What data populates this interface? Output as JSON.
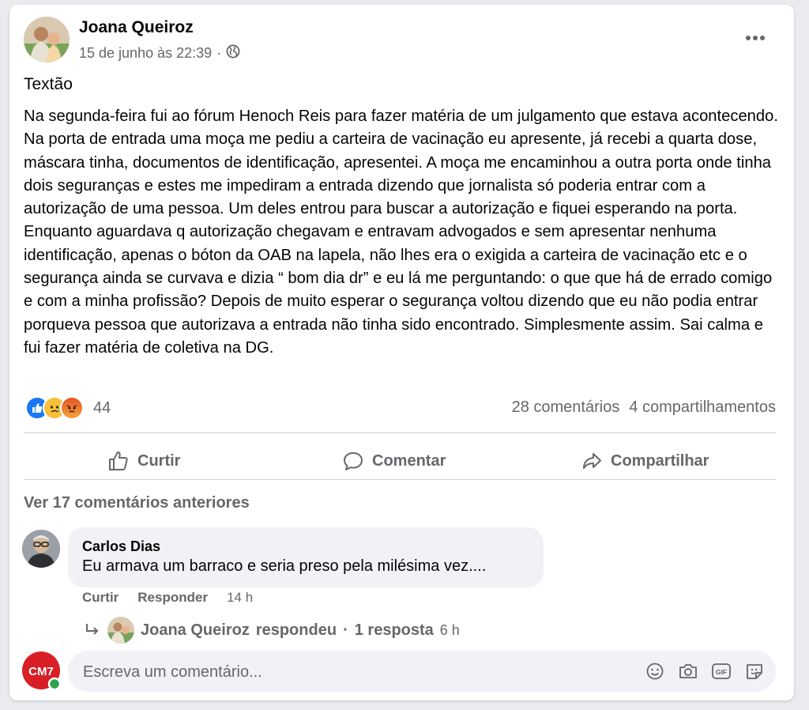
{
  "post": {
    "author": "Joana Queiroz",
    "timestamp": "15 de junho às 22:39",
    "separator": "·",
    "privacy_icon": "globe-icon",
    "title": "Textão",
    "body": "Na segunda-feira fui ao fórum Henoch Reis para fazer matéria de um julgamento que estava acontecendo. Na porta de entrada uma moça me pediu a carteira de vacinação eu apresente, já recebi a quarta dose, máscara tinha, documentos de identificação, apresentei. A moça me encaminhou a outra porta onde tinha dois seguranças e estes me impediram a entrada dizendo que jornalista só poderia entrar com a autorização de uma pessoa. Um deles entrou para buscar a autorização e fiquei esperando na porta. Enquanto aguardava q autorização chegavam e entravam advogados  e sem apresentar nenhuma identificação,  apenas o bóton da OAB na lapela, não  lhes era o exigida a carteira de vacinação etc e o segurança ainda se curvava e dizia “ bom dia dr” e eu lá me perguntando: o que que há de errado comigo e com a minha profissão? Depois de muito esperar  o segurança voltou dizendo que eu não podia entrar porqueva pessoa que autorizava a entrada  não tinha sido encontrado. Simplesmente assim.  Sai calma e fui fazer matéria de coletiva na DG."
  },
  "reactions": {
    "types": [
      "like",
      "sad",
      "angry"
    ],
    "count": "44",
    "comments": "28 comentários",
    "shares": "4 compartilhamentos"
  },
  "actions": {
    "like": "Curtir",
    "comment": "Comentar",
    "share": "Compartilhar"
  },
  "comments": {
    "view_previous": "Ver 17 comentários anteriores",
    "items": [
      {
        "author": "Carlos Dias",
        "text": "Eu armava um barraco e seria preso pela milésima vez....",
        "like": "Curtir",
        "reply": "Responder",
        "time": "14 h"
      }
    ],
    "reply_summary": {
      "author": "Joana Queiroz",
      "verb": "respondeu",
      "separator": "·",
      "count": "1 resposta",
      "time": "6 h"
    },
    "input_placeholder": "Escreva um comentário...",
    "user_avatar_text": "CM7"
  },
  "colors": {
    "like_blue": "#1877f2",
    "muted_text": "#65676b",
    "bubble_bg": "#f0f2f5",
    "brand_red": "#d81f26",
    "online_green": "#31a24c"
  }
}
